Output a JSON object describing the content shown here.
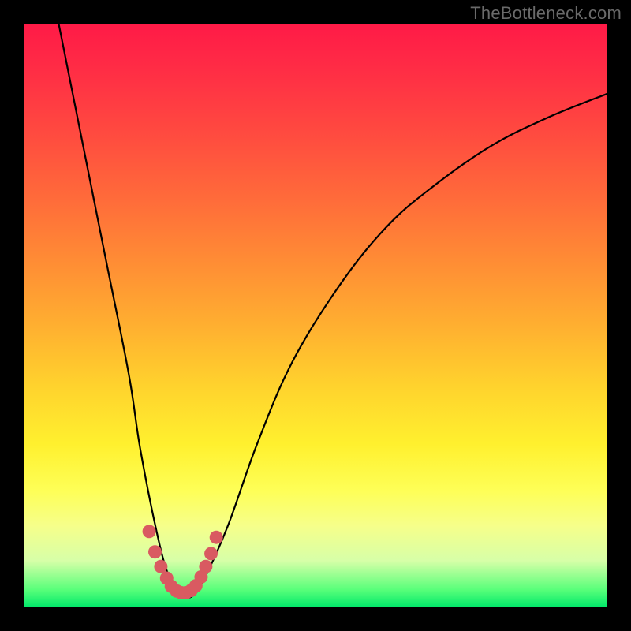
{
  "watermark": "TheBottleneck.com",
  "colors": {
    "frame": "#000000",
    "curve": "#000000",
    "dots": "#d95a61",
    "gradient_top": "#ff1a47",
    "gradient_bottom": "#00e86a"
  },
  "chart_data": {
    "type": "line",
    "title": "",
    "xlabel": "",
    "ylabel": "",
    "xlim": [
      0,
      100
    ],
    "ylim": [
      0,
      100
    ],
    "grid": false,
    "legend": null,
    "series": [
      {
        "name": "curve",
        "x": [
          6,
          10,
          14,
          18,
          20,
          23,
          25,
          27,
          29,
          31,
          35,
          40,
          46,
          54,
          62,
          70,
          80,
          90,
          100
        ],
        "y": [
          100,
          80,
          60,
          40,
          27,
          12,
          5,
          2,
          2,
          5,
          14,
          28,
          42,
          55,
          65,
          72,
          79,
          84,
          88
        ]
      }
    ],
    "dots": {
      "name": "bottom-dots",
      "x": [
        21.5,
        22.5,
        23.5,
        24.5,
        25.3,
        26.2,
        27.0,
        27.8,
        28.7,
        29.5,
        30.4,
        31.2,
        32.1,
        33.0
      ],
      "y": [
        13.0,
        9.5,
        7.0,
        5.0,
        3.6,
        2.8,
        2.5,
        2.5,
        2.9,
        3.7,
        5.2,
        7.0,
        9.2,
        12.0
      ]
    }
  }
}
